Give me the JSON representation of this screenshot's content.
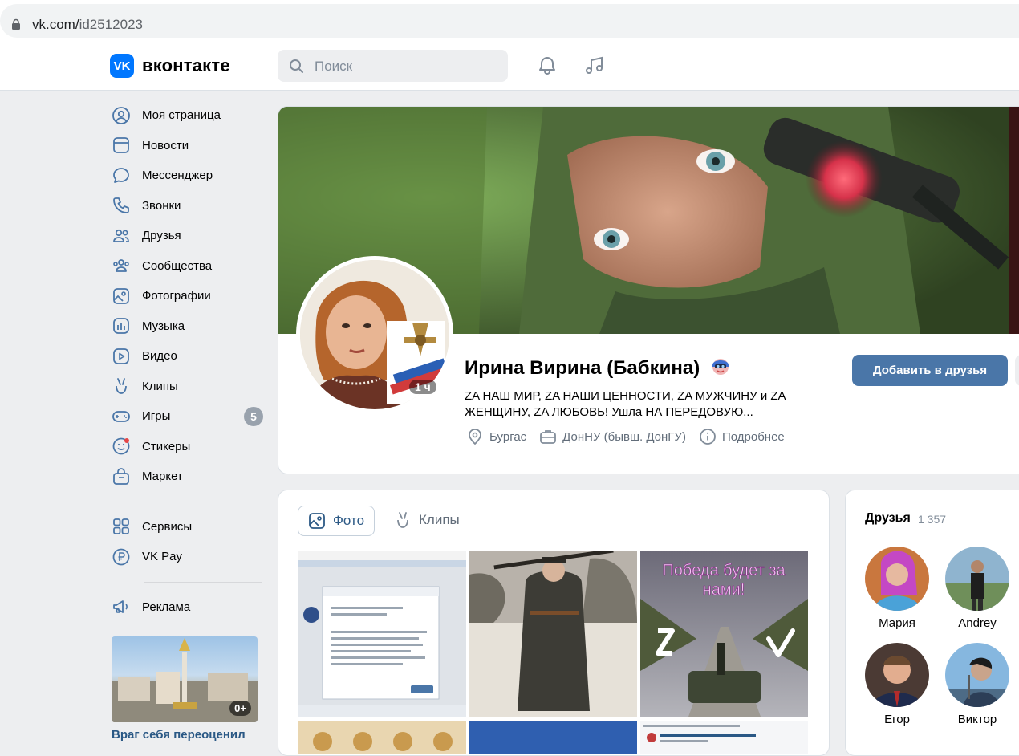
{
  "browser": {
    "url_host": "vk.com/",
    "url_path": "id2512023"
  },
  "header": {
    "logo_mark": "VK",
    "logo_text": "вконтакте",
    "search_placeholder": "Поиск"
  },
  "sidebar": {
    "items": [
      {
        "label": "Моя страница",
        "icon": "user-circle-icon"
      },
      {
        "label": "Новости",
        "icon": "news-icon"
      },
      {
        "label": "Мессенджер",
        "icon": "message-icon"
      },
      {
        "label": "Звонки",
        "icon": "phone-icon"
      },
      {
        "label": "Друзья",
        "icon": "users-icon"
      },
      {
        "label": "Сообщества",
        "icon": "community-icon"
      },
      {
        "label": "Фотографии",
        "icon": "photo-icon"
      },
      {
        "label": "Музыка",
        "icon": "music-icon"
      },
      {
        "label": "Видео",
        "icon": "video-icon"
      },
      {
        "label": "Клипы",
        "icon": "clips-icon"
      },
      {
        "label": "Игры",
        "icon": "gamepad-icon",
        "badge": "5"
      },
      {
        "label": "Стикеры",
        "icon": "sticker-icon"
      },
      {
        "label": "Маркет",
        "icon": "market-icon"
      }
    ],
    "extra": [
      {
        "label": "Сервисы",
        "icon": "services-icon"
      },
      {
        "label": "VK Pay",
        "icon": "vkpay-icon"
      }
    ],
    "ads": {
      "label": "Реклама",
      "icon": "megaphone-icon"
    },
    "promo": {
      "age": "0+",
      "title": "Враг себя переоценил"
    }
  },
  "profile": {
    "name": "Ирина Вирина (Бабкина)",
    "avatar_time": "1 ч",
    "status": "ZA НАШ МИР, ZA НАШИ ЦЕННОСТИ, ZA МУЖЧИНУ и ZA ЖЕНЩИНУ, ZA ЛЮБОВЬ! Ушла НА ПЕРЕДОВУЮ...",
    "city": "Бургас",
    "university": "ДонНУ (бывш. ДонГУ)",
    "more": "Подробнее",
    "add_friend": "Добавить в друзья"
  },
  "photos": {
    "tab_photo": "Фото",
    "tab_clips": "Клипы",
    "photo3_caption": "Победа будет за нами!"
  },
  "friends": {
    "title": "Друзья",
    "count": "1 357",
    "list": [
      {
        "name": "Мария"
      },
      {
        "name": "Andrey"
      },
      {
        "name": "Егор"
      },
      {
        "name": "Виктор"
      }
    ]
  },
  "colors": {
    "accent": "#4a76a8",
    "vk_blue": "#0077ff",
    "link": "#2a5885",
    "bg": "#edeef0"
  }
}
